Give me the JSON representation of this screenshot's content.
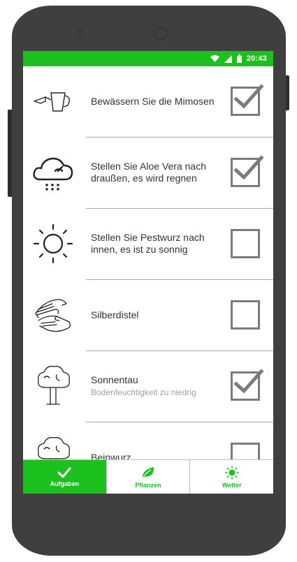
{
  "status_bar": {
    "time": "20:43",
    "icons": [
      "wifi-icon",
      "signal-icon",
      "battery-icon"
    ]
  },
  "tasks": [
    {
      "icon": "watering-can-icon",
      "title": "Bewässern Sie die Mimosen",
      "subtitle": "",
      "checked": true
    },
    {
      "icon": "rain-cloud-icon",
      "title": "Stellen Sie Aloe Vera nach draußen, es wird regnen",
      "subtitle": "",
      "checked": true
    },
    {
      "icon": "sun-icon",
      "title": "Stellen Sie Pestwurz nach innen, es ist zu sonnig",
      "subtitle": "",
      "checked": false
    },
    {
      "icon": "hands-icon",
      "title": "Silberdistel",
      "subtitle": "",
      "checked": false
    },
    {
      "icon": "tree-icon",
      "title": "Sonnentau",
      "subtitle": "Bodenfeuchtigkeit zu niedrig",
      "checked": true
    },
    {
      "icon": "tree-icon",
      "title": "Beinwurz",
      "subtitle": "",
      "checked": false
    }
  ],
  "tabs": [
    {
      "label": "Aufgaben",
      "icon": "checkmark-icon",
      "active": true
    },
    {
      "label": "Pflanzen",
      "icon": "leaf-icon",
      "active": false
    },
    {
      "label": "Wetter",
      "icon": "sun-icon",
      "active": false
    }
  ],
  "colors": {
    "accent": "#1dc11d",
    "phone_body": "#3f3f3f",
    "checkbox": "#7b7b7b",
    "divider": "#a9a9a9"
  }
}
